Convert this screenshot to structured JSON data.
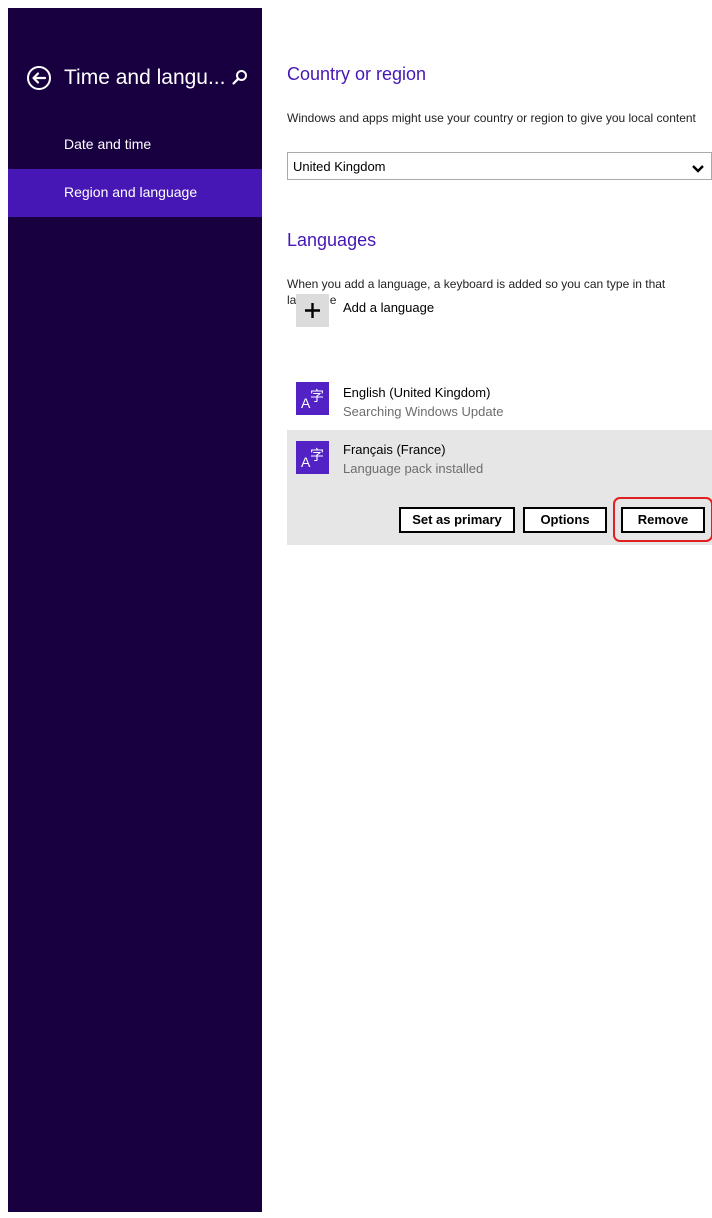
{
  "sidebar": {
    "title": "Time and langu...",
    "back_icon": "back-arrow-circle-icon",
    "search_icon": "search-icon",
    "items": [
      {
        "label": "Date and time",
        "selected": false
      },
      {
        "label": "Region and language",
        "selected": true
      }
    ]
  },
  "country": {
    "heading": "Country or region",
    "description": "Windows and apps might use your country or region to give you local content",
    "selected_value": "United Kingdom"
  },
  "languages": {
    "heading": "Languages",
    "description": "When you add a language, a keyboard is added so you can type in that language",
    "add_label": "Add a language",
    "items": [
      {
        "name": "English (United Kingdom)",
        "status": "Searching Windows Update"
      },
      {
        "name": "Français (France)",
        "status": "Language pack installed"
      }
    ],
    "actions": {
      "set_primary": "Set as primary",
      "options": "Options",
      "remove": "Remove"
    }
  },
  "colors": {
    "sidebar_bg": "#180040",
    "accent": "#4617b4",
    "highlight": "#e02020"
  }
}
